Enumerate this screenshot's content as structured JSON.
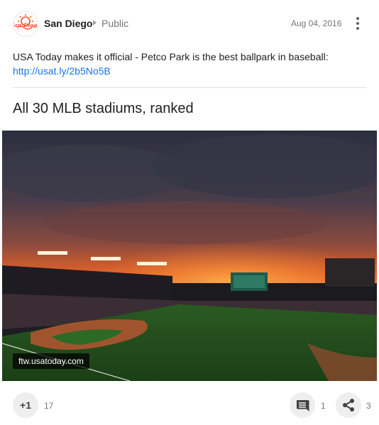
{
  "post": {
    "author": "San Diego",
    "visibility": "Public",
    "date": "Aug 04, 2016",
    "text": "USA Today makes it official - Petco Park is the best ballpark in baseball:",
    "link": "http://usat.ly/2b5No5B",
    "headline": "All 30 MLB stadiums, ranked",
    "source": "ftw.usatoday.com",
    "logo_text": "San Diego"
  },
  "actions": {
    "plus_label": "+1",
    "plus_count": "17",
    "comment_count": "1",
    "share_count": "3"
  },
  "icons": {
    "more": "more-vert-icon",
    "comment": "comment-icon",
    "share": "share-icon"
  },
  "colors": {
    "link": "#1a73e8",
    "logo_orange": "#e8552d"
  }
}
